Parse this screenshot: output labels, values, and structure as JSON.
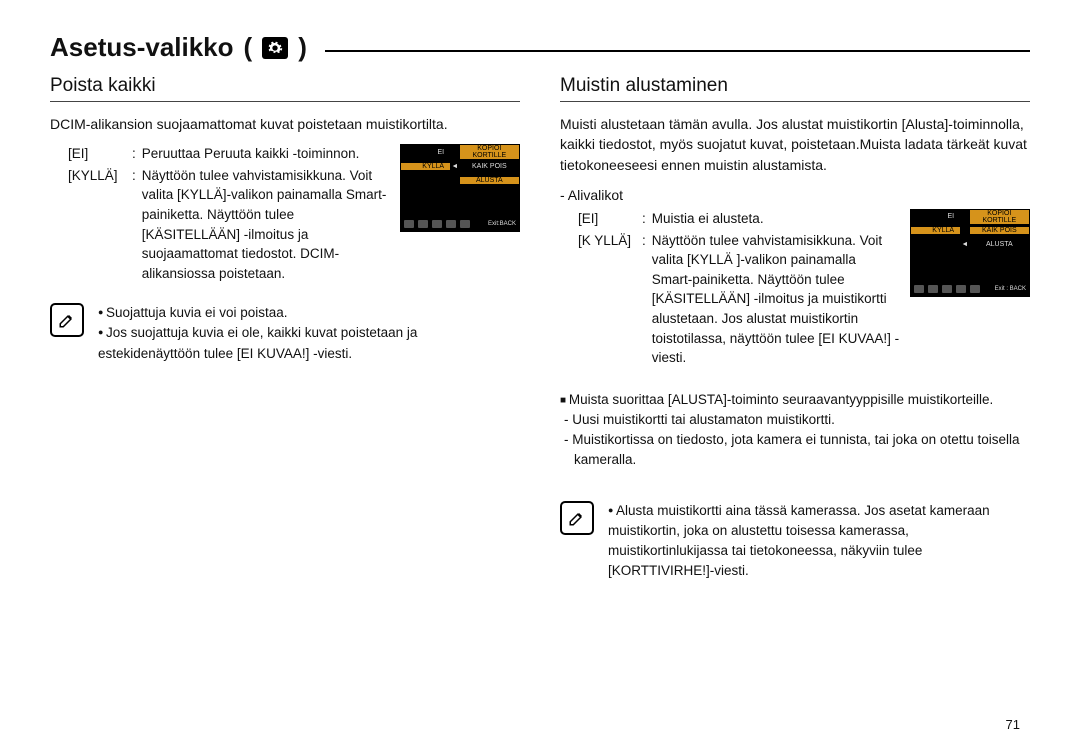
{
  "title": "Asetus-valikko",
  "title_open": "(",
  "title_close": ")",
  "page_number": "71",
  "left": {
    "heading": "Poista kaikki",
    "intro": "DCIM-alikansion suojaamattomat kuvat poistetaan muistikortilta.",
    "options": [
      {
        "key": "[EI]",
        "val": "Peruuttaa Peruuta kaikki -toiminnon."
      },
      {
        "key": "[KYLLÄ]",
        "val": "Näyttöön tulee vahvistamisikkuna. Voit valita [KYLLÄ]-valikon painamalla Smart-painiketta. Näyttöön tulee [KÄSITELLÄÄN] -ilmoitus ja suojaamattomat tiedostot. DCIM-alikansiossa poistetaan."
      }
    ],
    "notes": [
      "Suojattuja kuvia ei voi poistaa.",
      "Jos suojattuja kuvia ei ole, kaikki kuvat poistetaan ja estekidenäyttöön tulee [EI KUVAA!] -viesti."
    ],
    "lcd": {
      "rows": [
        {
          "left": "EI",
          "right": "KOPIOI KORTILLE",
          "leftHi": false,
          "rightHi": true
        },
        {
          "left": "KYLLÄ",
          "right": "KAIK POIS",
          "leftHi": true,
          "rightHi": false,
          "arrow": "◄"
        },
        {
          "left": "",
          "right": "ALUSTA",
          "leftHi": false,
          "rightHi": true
        }
      ],
      "footer": "Exit:BACK"
    }
  },
  "right": {
    "heading": "Muistin alustaminen",
    "intro": "Muisti alustetaan tämän avulla. Jos alustat muistikortin [Alusta]-toiminnolla, kaikki tiedostot, myös suojatut kuvat, poistetaan.Muista ladata tärkeät kuvat tietokoneeseesi ennen muistin alustamista.",
    "sub_label": "- Alivalikot",
    "options": [
      {
        "key": "[EI]",
        "val": "Muistia ei alusteta."
      },
      {
        "key": "[K YLLÄ]",
        "val": "Näyttöön tulee vahvistamisikkuna. Voit valita [KYLLÄ ]-valikon painamalla Smart-painiketta. Näyttöön tulee [KÄSITELLÄÄN] -ilmoitus ja muistikortti alustetaan. Jos alustat muistikortin toistotilassa, näyttöön tulee [EI KUVAA!] -viesti."
      }
    ],
    "sq_note": "Muista suorittaa [ALUSTA]-toiminto seuraavantyyppisille muistikorteille.",
    "dash_notes": [
      "Uusi muistikortti tai alustamaton muistikortti.",
      "Muistikortissa on tiedosto, jota kamera ei tunnista, tai joka on otettu toisella kameralla."
    ],
    "bottom_notes": [
      "Alusta muistikortti aina tässä kamerassa. Jos asetat kameraan muistikortin, joka on alustettu toisessa kamerassa, muistikortinlukijassa tai tietokoneessa, näkyviin tulee [KORTTIVIRHE!]-viesti."
    ],
    "lcd": {
      "rows": [
        {
          "left": "EI",
          "right": "KOPIOI KORTILLE",
          "leftHi": false,
          "rightHi": true
        },
        {
          "left": "KYLLÄ",
          "right": "KAIK POIS",
          "leftHi": true,
          "rightHi": true
        },
        {
          "left": "",
          "right": "ALUSTA",
          "leftHi": false,
          "rightHi": false,
          "arrow": "◄"
        }
      ],
      "footer": "Exit : BACK"
    }
  }
}
